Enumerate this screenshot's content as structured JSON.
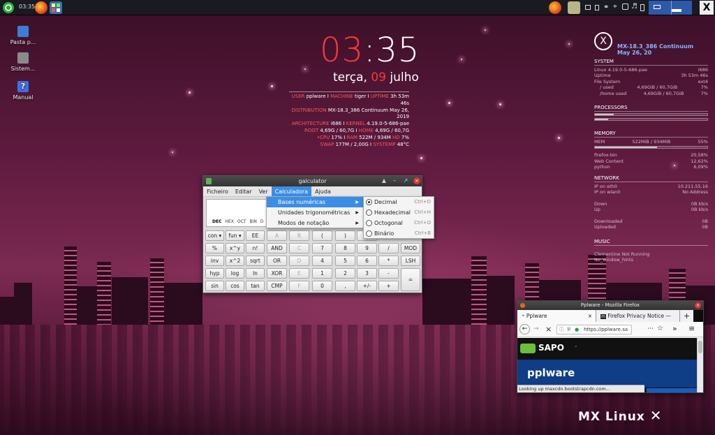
{
  "panel": {
    "time": "03:35",
    "icons": [
      "mx-menu-icon",
      "firefox-icon",
      "file-manager-icon"
    ],
    "tray_icons": [
      "firefox-tray-icon",
      "box-icon",
      "display-icon",
      "network-icon",
      "attach-icon",
      "wifi-icon",
      "updates-icon",
      "volume-icon",
      "battery-icon",
      "workspace-pager",
      "mx-logo-icon"
    ]
  },
  "desktop": {
    "icons": [
      {
        "label": "Pasta p..."
      },
      {
        "label": "Sistem..."
      },
      {
        "label": "Manual"
      }
    ]
  },
  "clock": {
    "hour": "03",
    "sep": ":",
    "minute": "35",
    "day": "terça,",
    "date_num": "09",
    "month": "julho"
  },
  "sysinfo": {
    "lines": [
      [
        {
          "k": "USER"
        },
        {
          "v": " pplware I "
        },
        {
          "k": "MACHINE"
        },
        {
          "v": " tiger I "
        },
        {
          "k": "UPTIME"
        },
        {
          "v": " 3h 53m 46s"
        }
      ],
      [
        {
          "k": "DISTRIBUTION"
        },
        {
          "v": " MX-18.3_386 Continuum May 26, 2019"
        }
      ],
      [
        {
          "k": "ARCHITECTURE"
        },
        {
          "v": " i686 I "
        },
        {
          "k": "KERNEL"
        },
        {
          "v": " 4.19.0-5-686-pae"
        }
      ],
      [
        {
          "k": "ROOT"
        },
        {
          "v": " 4,69G / 60,7G I "
        },
        {
          "k": "HOME"
        },
        {
          "v": " 4,69G / 60,7G"
        }
      ],
      [
        {
          "k": "•CPU"
        },
        {
          "v": " 17% I "
        },
        {
          "k": "RAM"
        },
        {
          "v": " 522M / 934M "
        },
        {
          "k": "HD"
        },
        {
          "v": " 7%"
        }
      ],
      [
        {
          "k": "SWAP"
        },
        {
          "v": " 177M / 2,00G I "
        },
        {
          "k": "SYSTEMP"
        },
        {
          "v": " 48°C"
        }
      ]
    ]
  },
  "conky": {
    "title": "MX-18.3_386 Continuum May 26, 20",
    "system": {
      "header": "SYSTEM",
      "rows": [
        [
          "Linux 4.19.0-5-686-pae",
          "i686"
        ],
        [
          "Uptime",
          "3h 53m 46s"
        ],
        [
          "File System",
          "ext4"
        ],
        [
          "/     used",
          "4,69GiB / 60,7GiB",
          "7%"
        ],
        [
          "/home used",
          "4,69GiB / 60,7GiB",
          "7%"
        ]
      ]
    },
    "processors": {
      "header": "PROCESSORS",
      "bars": [
        0.17,
        0.12
      ]
    },
    "memory": {
      "header": "MEMORY",
      "mem_label": "MEM",
      "mem_value": "522MiB / 934MiB",
      "mem_pct": "55%",
      "mem_fill": 0.55,
      "rows": [
        [
          "firefox-bin",
          "20,58%"
        ],
        [
          "Web Content",
          "12,62%"
        ],
        [
          "python",
          "6,09%"
        ]
      ]
    },
    "network": {
      "header": "NETWORK",
      "rows": [
        [
          "IP on eth0",
          "10.211.55.16"
        ],
        [
          "IP on wlan0",
          "No Address"
        ],
        [
          "",
          ""
        ],
        [
          "Down",
          "0B   kb/s"
        ],
        [
          "Up",
          "0B   kb/s"
        ],
        [
          "",
          ""
        ],
        [
          "Downloaded",
          "0B"
        ],
        [
          "Uploaded",
          "0B"
        ]
      ]
    },
    "music": {
      "header": "MUSIC",
      "rows": [
        "Clementine Not Running",
        "No_window_hints"
      ]
    }
  },
  "galculator": {
    "title": "galculator",
    "menu": [
      "Ficheiro",
      "Editar",
      "Ver",
      "Calculadora",
      "Ajuda"
    ],
    "bases": [
      "DEC",
      "HEX",
      "OCT",
      "BIN",
      "D"
    ],
    "keys": [
      [
        "con ▾",
        "fun ▾",
        "EE",
        "A",
        "B",
        "(",
        ")",
        "M"
      ],
      [
        "%",
        "x^y",
        "n!",
        "AND",
        "C",
        "7",
        "8",
        "9",
        "/",
        "MOD"
      ],
      [
        "inv",
        "x^2",
        "sqrt",
        "OR",
        "D",
        "4",
        "5",
        "6",
        "*",
        "LSH"
      ],
      [
        "hyp",
        "log",
        "ln",
        "XOR",
        "E",
        "1",
        "2",
        "3",
        "-"
      ],
      [
        "sin",
        "cos",
        "tan",
        "CMP",
        "F",
        "0",
        ",",
        "+/-",
        "+"
      ],
      [
        "="
      ]
    ],
    "submenu": [
      {
        "label": "Bases numéricas"
      },
      {
        "label": "Unidades trigonométricas"
      },
      {
        "label": "Modos de notação"
      }
    ],
    "bases_menu": [
      {
        "label": "Decimal",
        "shortcut": "Ctrl+D",
        "selected": true
      },
      {
        "label": "Hexadecimal",
        "shortcut": "Ctrl+H"
      },
      {
        "label": "Octogonal",
        "shortcut": "Ctrl+O"
      },
      {
        "label": "Binário",
        "shortcut": "Ctrl+B"
      }
    ]
  },
  "firefox": {
    "title": "Pplware - Mozilla Firefox",
    "tabs": [
      "Pplware",
      "Firefox Privacy Notice —"
    ],
    "url": "https://pplware.sa",
    "sapo": "SAPO",
    "pplware": "pplware",
    "status": "Looking up maxcdn.bootstrapcdn.com..."
  },
  "brand": "MX Linux"
}
